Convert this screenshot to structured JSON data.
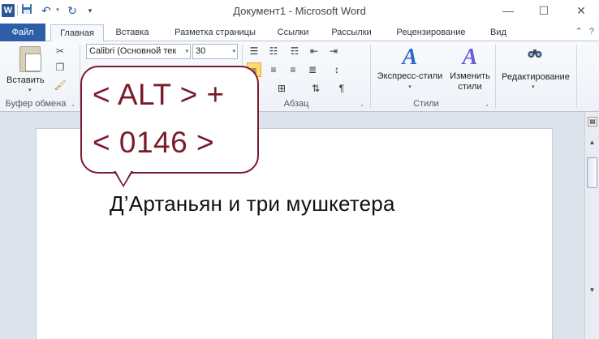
{
  "window": {
    "title": "Документ1  -  Microsoft Word",
    "app_icon": "W",
    "minimize": "—",
    "maximize": "☐",
    "close": "✕"
  },
  "qat": {
    "save_icon": "save-icon",
    "undo_icon": "undo-icon",
    "redo_icon": "redo-icon",
    "customize_icon": "customize-qat-icon"
  },
  "tabs": {
    "file": "Файл",
    "items": [
      "Главная",
      "Вставка",
      "Разметка страницы",
      "Ссылки",
      "Рассылки",
      "Рецензирование",
      "Вид"
    ],
    "active_index": 0
  },
  "ribbon": {
    "clipboard": {
      "paste_label": "Вставить",
      "group_label": "Буфер обмена"
    },
    "font": {
      "font_name": "Calibri (Основной тек",
      "font_size": "30"
    },
    "paragraph": {
      "group_label": "Абзац",
      "pilcrow": "¶"
    },
    "styles": {
      "express_styles": "Экспресс-стили",
      "change_styles_line1": "Изменить",
      "change_styles_line2": "стили",
      "group_label": "Стили"
    },
    "editing": {
      "label": "Редактирование"
    }
  },
  "callout": {
    "line1": "< ALT > +",
    "line2": "< 0146 >",
    "color": "#7a1a2a"
  },
  "document": {
    "text": "Д’Артаньян и три мушкетера"
  },
  "colors": {
    "file_tab": "#2c5fa8",
    "accent": "#2b579a",
    "highlight": "#ffd86e"
  }
}
